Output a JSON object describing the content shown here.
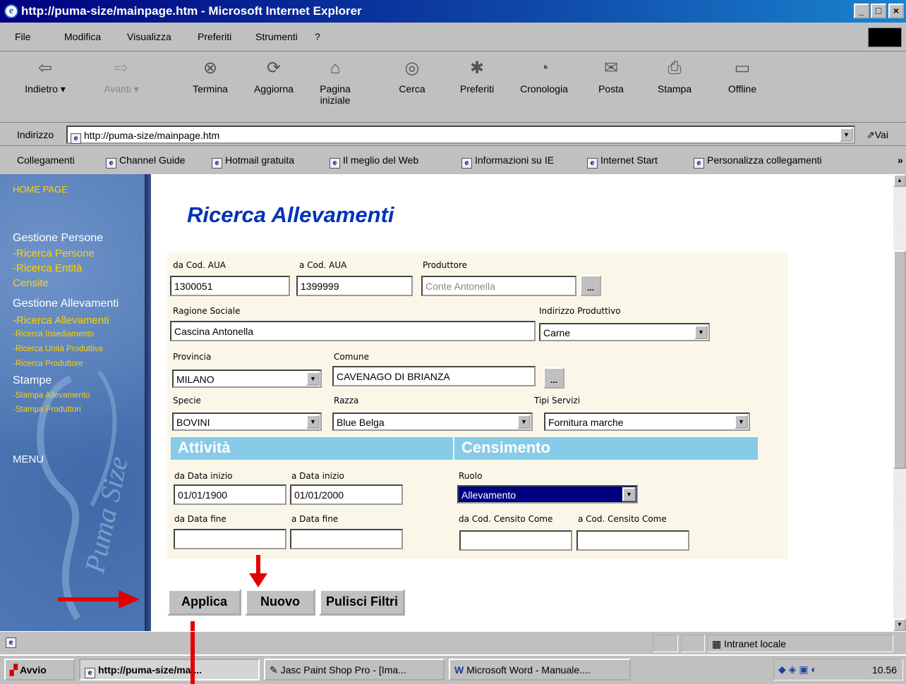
{
  "window": {
    "title": "http://puma-size/mainpage.htm - Microsoft Internet Explorer",
    "controls": [
      "_",
      "□",
      "×"
    ]
  },
  "menu": [
    "File",
    "Modifica",
    "Visualizza",
    "Preferiti",
    "Strumenti",
    "?"
  ],
  "toolbar": [
    {
      "label": "Indietro",
      "icon": "back-arrow-icon"
    },
    {
      "label": "Avanti",
      "icon": "forward-arrow-icon"
    },
    {
      "label": "Termina",
      "icon": "stop-icon"
    },
    {
      "label": "Aggiorna",
      "icon": "refresh-icon"
    },
    {
      "label": "Pagina iniziale",
      "icon": "home-icon"
    },
    {
      "label": "Cerca",
      "icon": "search-icon"
    },
    {
      "label": "Preferiti",
      "icon": "favorites-icon"
    },
    {
      "label": "Cronologia",
      "icon": "history-icon"
    },
    {
      "label": "Posta",
      "icon": "mail-icon"
    },
    {
      "label": "Stampa",
      "icon": "print-icon"
    },
    {
      "label": "Offline",
      "icon": "offline-icon"
    }
  ],
  "address": {
    "label": "Indirizzo",
    "url": "http://puma-size/mainpage.htm",
    "go": "Vai"
  },
  "links": {
    "label": "Collegamenti",
    "items": [
      "Channel Guide",
      "Hotmail gratuita",
      "Il meglio del Web",
      "Informazioni su IE",
      "Internet Start",
      "Personalizza collegamenti"
    ],
    "more": "»"
  },
  "sidebar": {
    "home": "HOME PAGE",
    "g1": "Gestione Persone",
    "ricerca_persone": "-Ricerca Persone",
    "ricerca_entita": "-Ricerca Entità",
    "censite": "Censite",
    "g2": "Gestione Allevamenti",
    "ricerca_allevamenti": "-Ricerca Allevamenti",
    "ricerca_insediamento": "-Ricerca Insediamento",
    "ricerca_unita": "-Ricerca Unità Produttiva",
    "ricerca_produttore": "-Ricerca Produttore",
    "g3": "Stampe",
    "stampa_allevamento": "-Stampa Allevamento",
    "stampa_produttori": "-Stampa Produttori",
    "menu": "MENU",
    "logo": "Puma Size"
  },
  "page": {
    "title": "Ricerca Allevamenti"
  },
  "form": {
    "da_cod_aua": {
      "label": "da Cod. AUA",
      "value": "1300051"
    },
    "a_cod_aua": {
      "label": "a Cod. AUA",
      "value": "1399999"
    },
    "produttore": {
      "label": "Produttore",
      "value": "Conte Antonella"
    },
    "ragione_sociale": {
      "label": "Ragione Sociale",
      "value": "Cascina Antonella"
    },
    "indirizzo_produttivo": {
      "label": "Indirizzo Produttivo",
      "value": "Carne"
    },
    "provincia": {
      "label": "Provincia",
      "value": "MILANO"
    },
    "comune": {
      "label": "Comune",
      "value": "CAVENAGO DI BRIANZA"
    },
    "specie": {
      "label": "Specie",
      "value": "BOVINI"
    },
    "razza": {
      "label": "Razza",
      "value": "Blue Belga"
    },
    "tipi_servizi": {
      "label": "Tipi Servizi",
      "value": "Fornitura marche"
    },
    "section_attivita": "Attività",
    "section_censimento": "Censimento",
    "da_data_inizio": {
      "label": "da Data inizio",
      "value": "01/01/1900"
    },
    "a_data_inizio": {
      "label": "a Data inizio",
      "value": "01/01/2000"
    },
    "ruolo": {
      "label": "Ruolo",
      "value": "Allevamento"
    },
    "da_data_fine": {
      "label": "da Data fine",
      "value": ""
    },
    "a_data_fine": {
      "label": "a Data fine",
      "value": ""
    },
    "da_cod_censito": {
      "label": "da Cod. Censito Come",
      "value": ""
    },
    "a_cod_censito": {
      "label": "a Cod. Censito Come",
      "value": ""
    },
    "browse": "..."
  },
  "buttons": {
    "applica": "Applica",
    "nuovo": "Nuovo",
    "pulisci": "Pulisci Filtri"
  },
  "status": {
    "zone": "Intranet locale"
  },
  "taskbar": {
    "start": "Avvio",
    "tasks": [
      "http://puma-size/mai...",
      "Jasc Paint Shop Pro - [Ima...",
      "Microsoft Word - Manuale...."
    ],
    "clock": "10.56"
  },
  "colors": {
    "titlebar": "#000080",
    "page_title": "#0033b8",
    "section_band": "#87cbe8",
    "sidebar": "#4f79b6",
    "sidebar_link": "#ffd200",
    "arrow": "#e30000"
  }
}
